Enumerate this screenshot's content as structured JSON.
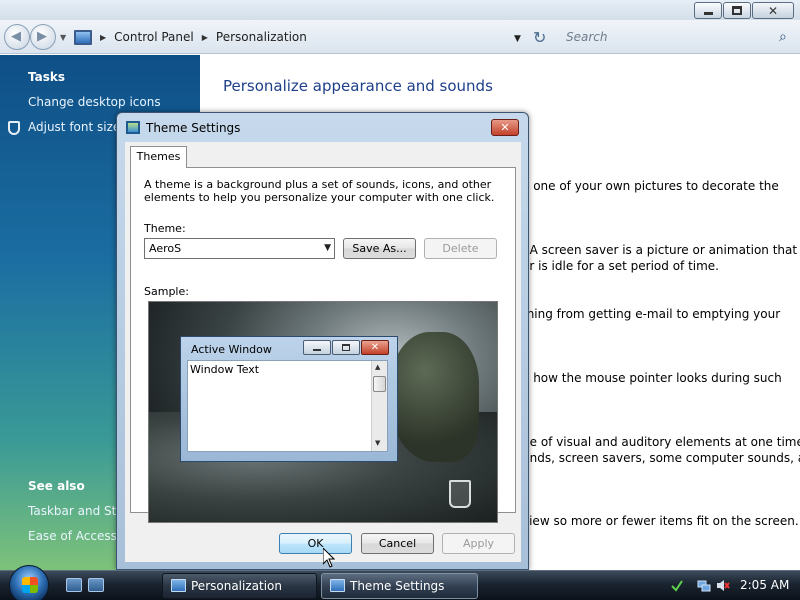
{
  "address": {
    "crumbs": [
      "Control Panel",
      "Personalization"
    ],
    "search_placeholder": "Search"
  },
  "taskpane": {
    "tasks_heading": "Tasks",
    "tasks": [
      "Change desktop icons",
      "Adjust font size (DPI)"
    ],
    "see_also_heading": "See also",
    "see_also": [
      "Taskbar and Start Menu",
      "Ease of Access"
    ]
  },
  "main": {
    "title": "Personalize appearance and sounds",
    "fragments": [
      "e one of your own pictures to decorate the",
      ". A screen saver is a picture or animation that",
      "er is idle for a set period of time.",
      "thing from getting e-mail to emptying your",
      "e how the mouse pointer looks during such",
      "ge of visual and auditory elements at one time",
      "unds, screen savers, some computer sounds, and",
      "view so more or fewer items fit on the screen."
    ]
  },
  "dialog": {
    "title": "Theme Settings",
    "tab": "Themes",
    "description": "A theme is a background plus a set of sounds, icons, and other elements to help you personalize your computer with one click.",
    "theme_label": "Theme:",
    "theme_value": "AeroS",
    "save_as": "Save As...",
    "delete": "Delete",
    "sample_label": "Sample:",
    "sample_window_title": "Active Window",
    "sample_window_text": "Window Text",
    "ok": "OK",
    "cancel": "Cancel",
    "apply": "Apply"
  },
  "taskbar": {
    "buttons": [
      "Personalization",
      "Theme Settings"
    ],
    "clock": "2:05 AM"
  }
}
